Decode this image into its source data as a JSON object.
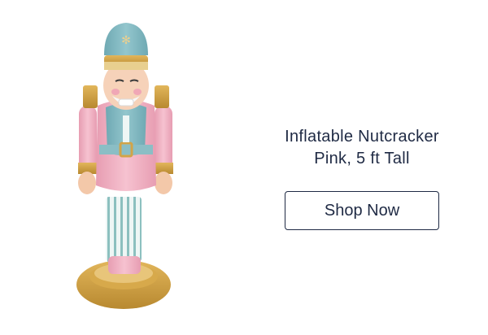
{
  "product": {
    "title_line1": "Inflatable Nutcracker",
    "title_line2": "Pink, 5 ft Tall",
    "image_icon": "nutcracker-inflatable-image"
  },
  "cta": {
    "label": "Shop Now"
  },
  "colors": {
    "text": "#1f2a44",
    "border": "#1f2a44",
    "accent_teal": "#7fb8c0",
    "accent_pink": "#f0b3c4",
    "accent_gold": "#c99a3c"
  }
}
